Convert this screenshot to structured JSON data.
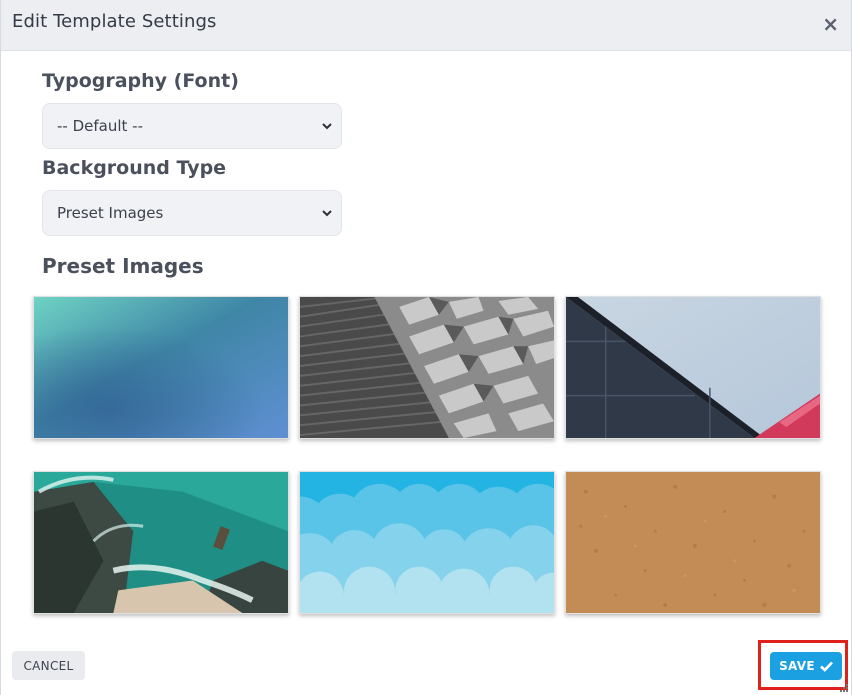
{
  "dialog": {
    "title": "Edit Template Settings",
    "close_glyph": "×"
  },
  "typography": {
    "label": "Typography (Font)",
    "selected": "-- Default --"
  },
  "background": {
    "label": "Background Type",
    "selected": "Preset Images"
  },
  "preset_images": {
    "label": "Preset Images",
    "items": [
      {
        "name": "gradient-teal-blue"
      },
      {
        "name": "building-facade-angular"
      },
      {
        "name": "building-corner-sky"
      },
      {
        "name": "aerial-beach-ocean"
      },
      {
        "name": "blue-clouds"
      },
      {
        "name": "cork-texture"
      }
    ]
  },
  "footer": {
    "cancel_label": "CANCEL",
    "save_label": "SAVE",
    "save_icon": "check-icon"
  },
  "colors": {
    "save_button": "#1ba1e2",
    "highlight": "#e0201b",
    "header_bg": "#eceef1"
  }
}
